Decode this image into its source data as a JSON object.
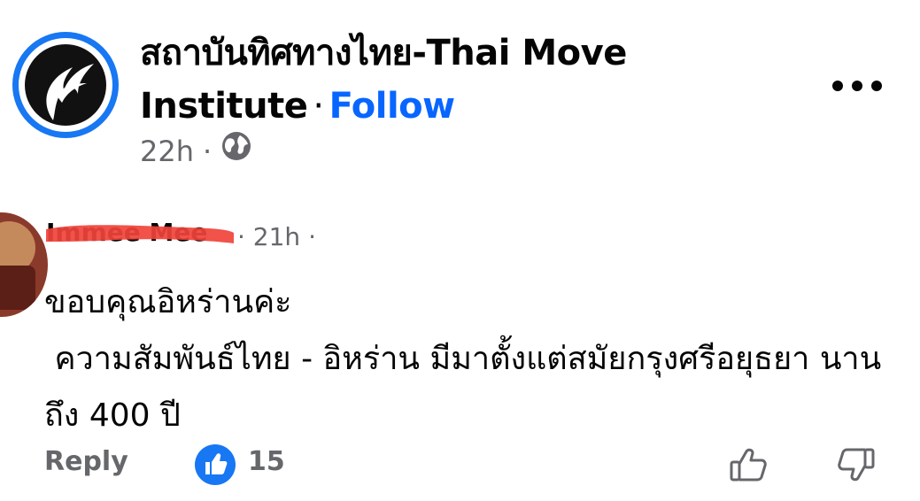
{
  "post": {
    "page_name": "สถาบันทิศทางไทย-Thai Move Institute",
    "separator": "·",
    "follow_label": "Follow",
    "time": "22h",
    "meta_separator": "·",
    "audience_icon": "globe-icon",
    "more_icon": "more-options-icon"
  },
  "comment": {
    "commenter_name": "Immee Mee",
    "time": "· 21h ·",
    "text": "ขอบคุณอิหร่านค่ะ\n ความสัมพันธ์ไทย - อิหร่าน มีมาตั้งแต่สมัยกรุงศรีอยุธยา นานถึง 400 ปี",
    "reply_label": "Reply",
    "like_count": "15",
    "colors": {
      "accent": "#0866ff",
      "secondary_text": "#65676b",
      "redaction": "#f0433a"
    }
  }
}
